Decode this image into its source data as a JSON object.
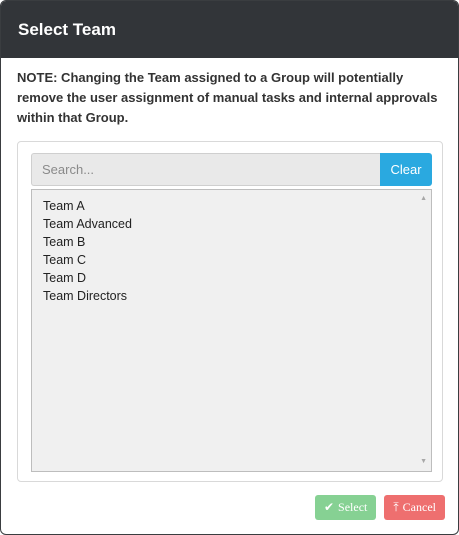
{
  "dialog": {
    "title": "Select Team",
    "note": "NOTE: Changing the Team assigned to a Group will potentially remove the user assignment of manual tasks and internal approvals within that Group."
  },
  "search": {
    "placeholder": "Search...",
    "value": "",
    "clear_label": "Clear"
  },
  "teams": [
    "Team A",
    "Team Advanced",
    "Team B",
    "Team C",
    "Team D",
    "Team Directors"
  ],
  "footer": {
    "select_icon": "✔",
    "select_label": "Select",
    "cancel_icon": "⤒",
    "cancel_label": "Cancel"
  },
  "colors": {
    "header_bg": "#323539",
    "clear_button": "#2aa9e0",
    "select_button": "#86d193",
    "cancel_button": "#ee6f6f"
  }
}
